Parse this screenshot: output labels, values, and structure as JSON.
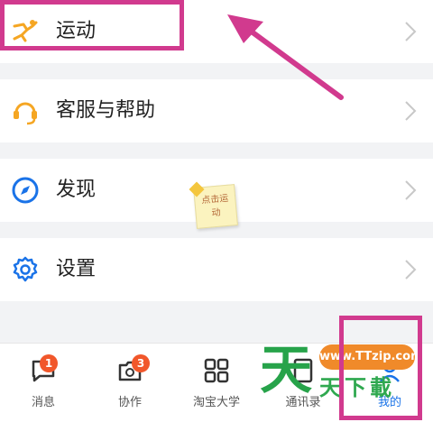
{
  "menu": {
    "sport": {
      "label": "运动",
      "icon": "running-person-icon"
    },
    "service": {
      "label": "客服与帮助",
      "icon": "headset-icon"
    },
    "discover": {
      "label": "发现",
      "icon": "compass-icon"
    },
    "settings": {
      "label": "设置",
      "icon": "gear-icon"
    }
  },
  "sticky_note": {
    "text_line1": "点击运",
    "text_line2": "动"
  },
  "tabbar": {
    "tabs": [
      {
        "label": "消息",
        "icon": "chat-bubble-icon",
        "badge": "1"
      },
      {
        "label": "协作",
        "icon": "collaboration-icon",
        "badge": "3"
      },
      {
        "label": "淘宝大学",
        "icon": "grid-apps-icon"
      },
      {
        "label": "通讯录",
        "icon": "contacts-icon"
      },
      {
        "label": "我的",
        "icon": "profile-icon"
      }
    ]
  },
  "watermark": {
    "logo_char": "天",
    "url": "www.TTzip.com",
    "text": "天下載"
  },
  "colors": {
    "highlight": "#d13a8e",
    "accent_blue": "#1a73e8",
    "accent_orange": "#f5a623",
    "badge": "#f1572b"
  }
}
